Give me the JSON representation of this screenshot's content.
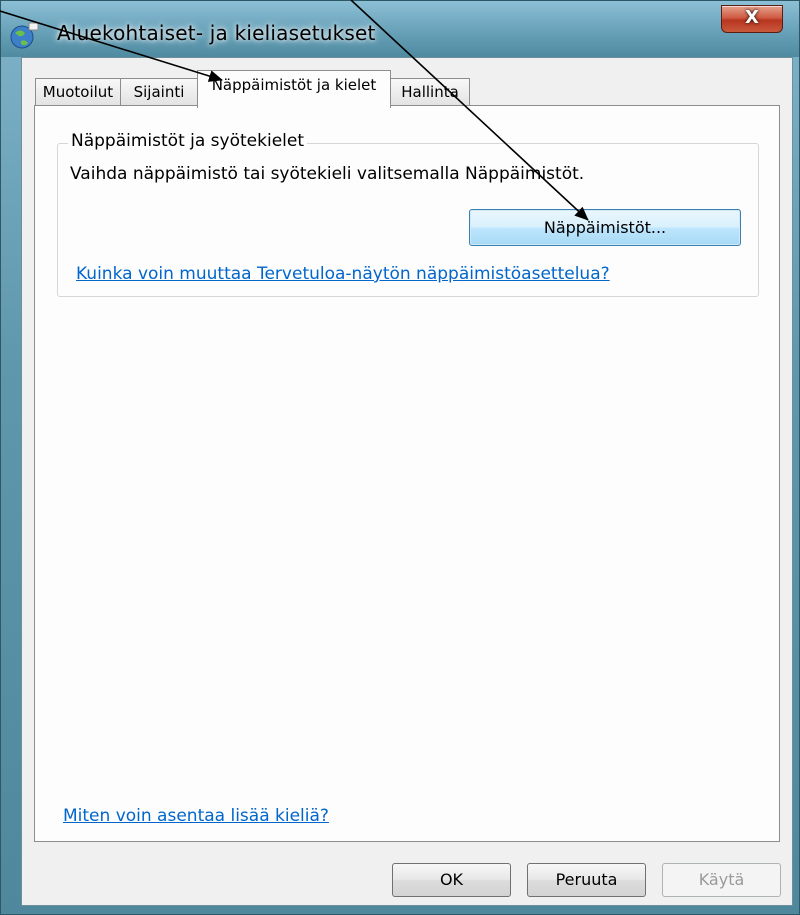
{
  "window": {
    "title": "Aluekohtaiset- ja kieliasetukset",
    "close_label": "X"
  },
  "tabs": [
    {
      "label": "Muotoilut",
      "active": false
    },
    {
      "label": "Sijainti",
      "active": false
    },
    {
      "label": "Näppäimistöt ja kielet",
      "active": true
    },
    {
      "label": "Hallinta",
      "active": false
    }
  ],
  "group": {
    "legend": "Näppäimistöt ja syötekielet",
    "description": "Vaihda näppäimistö tai syötekieli valitsemalla Näppäimistöt.",
    "keyboards_button": "Näppäimistöt...",
    "welcome_link": "Kuinka voin muuttaa Tervetuloa-näytön näppäimistöasettelua?"
  },
  "install_link": "Miten voin asentaa lisää kieliä?",
  "footer": {
    "ok": "OK",
    "cancel": "Peruuta",
    "apply": "Käytä"
  },
  "colors": {
    "link": "#0066cc",
    "close_button": "#c4462e",
    "frame": "#5f97ad"
  }
}
